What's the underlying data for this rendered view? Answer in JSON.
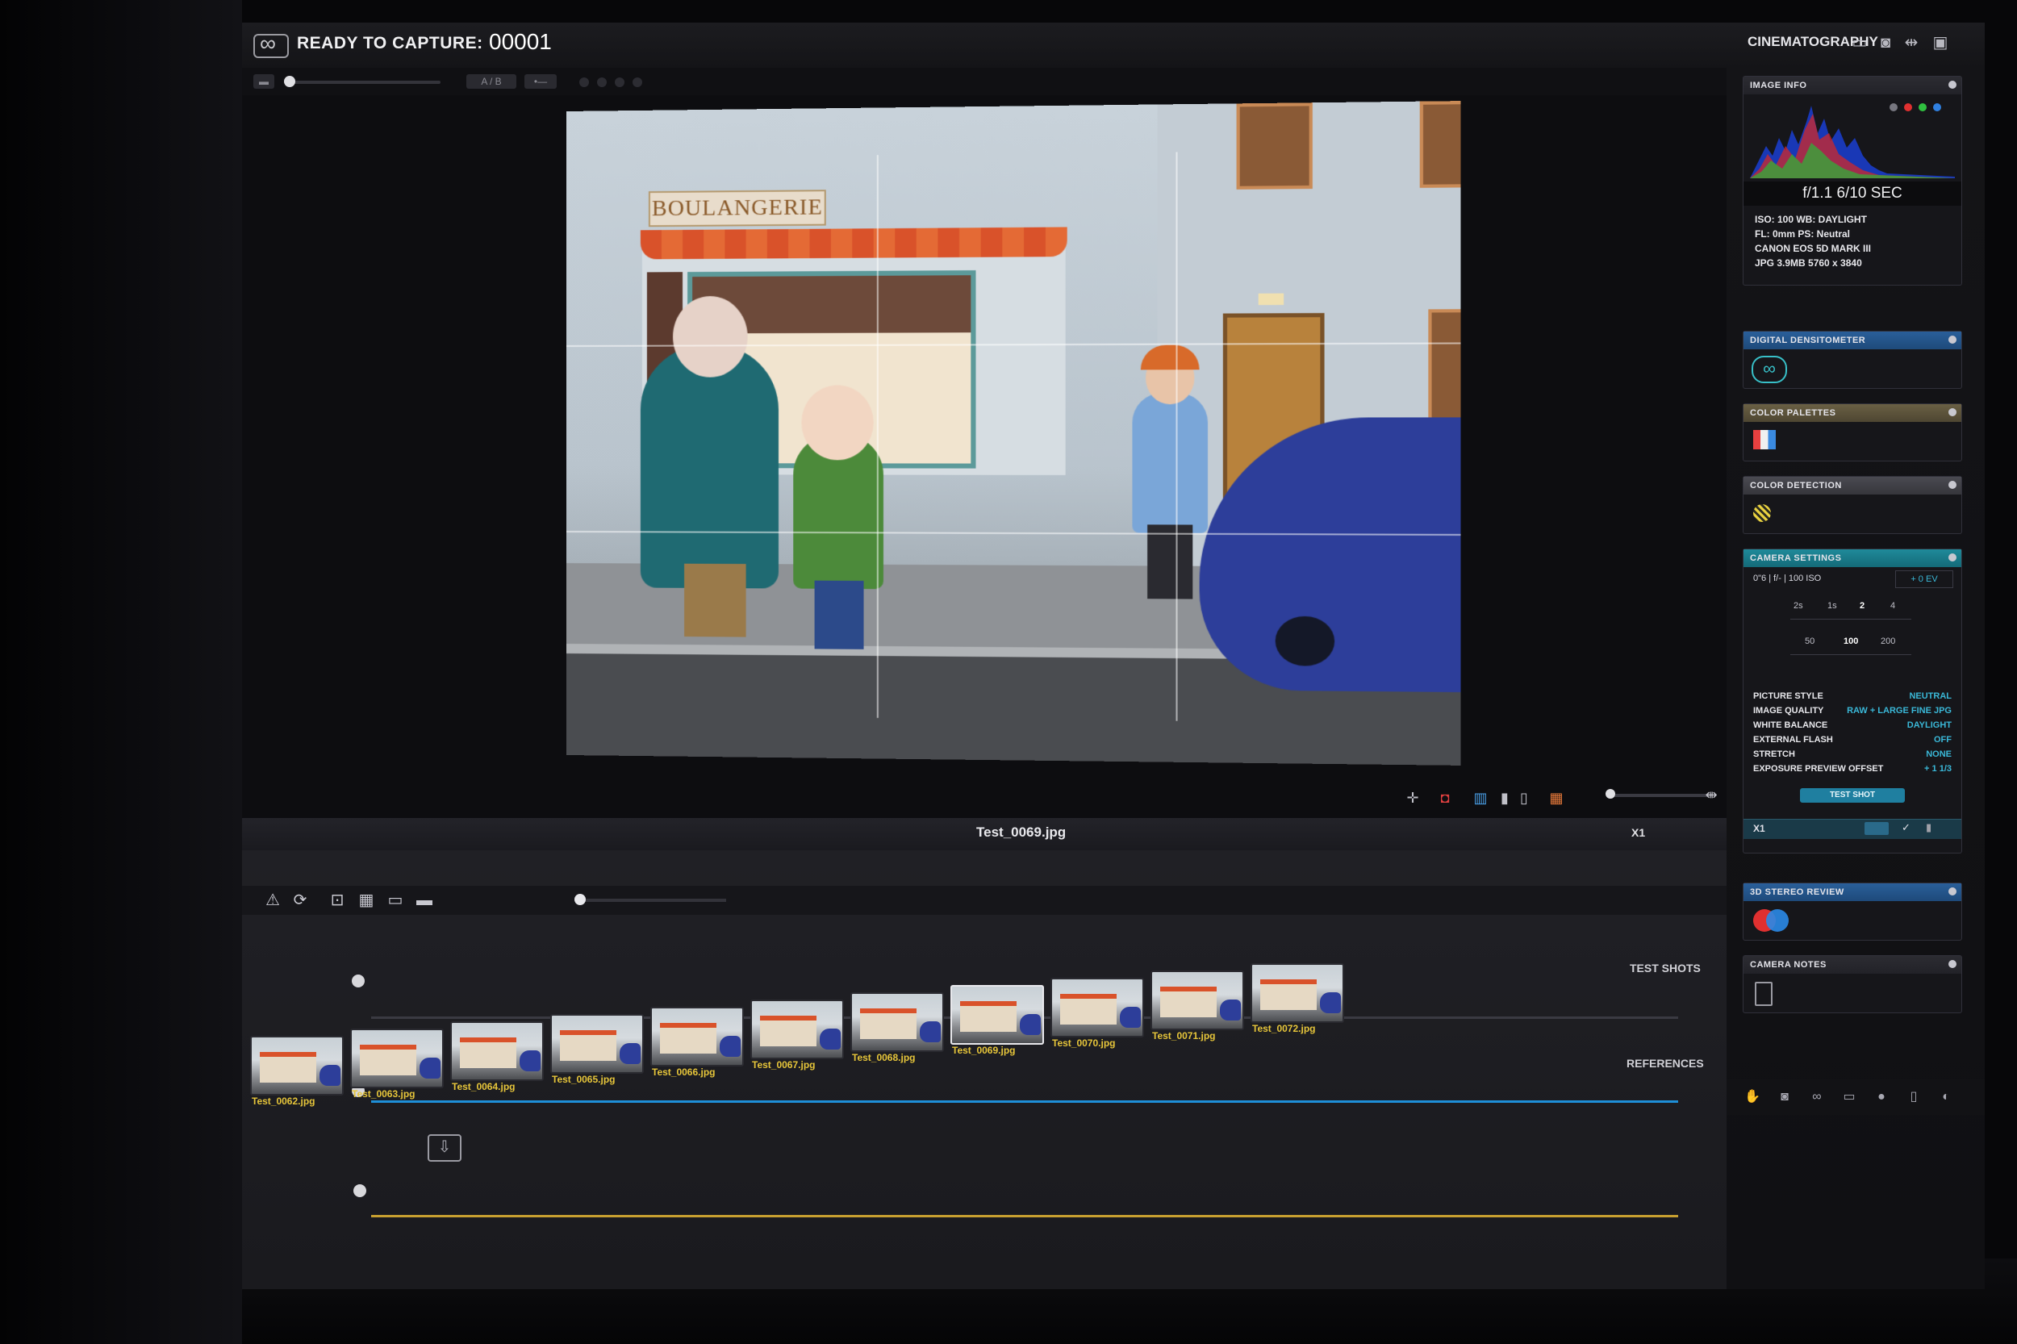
{
  "app": {
    "capture_status": "READY TO CAPTURE:",
    "frame_number": "00001",
    "workspace": "CINEMATOGRAPHY",
    "ab_toggle": "A / B"
  },
  "viewer": {
    "scene_sign": "BOULANGERIE",
    "filename": "Test_0069.jpg",
    "zoom": "X1"
  },
  "timeline": {
    "tracks": [
      {
        "label": "TEST SHOTS",
        "accent": "#1e8fd8"
      },
      {
        "label": "REFERENCES",
        "accent": "#1e8fd8"
      },
      {
        "label": "",
        "accent": "#c8a030"
      }
    ],
    "thumbnails": [
      {
        "label": "Test_0062.jpg",
        "selected": false
      },
      {
        "label": "Test_0063.jpg",
        "selected": false
      },
      {
        "label": "Test_0064.jpg",
        "selected": false
      },
      {
        "label": "Test_0065.jpg",
        "selected": false
      },
      {
        "label": "Test_0066.jpg",
        "selected": false
      },
      {
        "label": "Test_0067.jpg",
        "selected": false
      },
      {
        "label": "Test_0068.jpg",
        "selected": false
      },
      {
        "label": "Test_0069.jpg",
        "selected": true
      },
      {
        "label": "Test_0070.jpg",
        "selected": false
      },
      {
        "label": "Test_0071.jpg",
        "selected": false
      },
      {
        "label": "Test_0072.jpg",
        "selected": false
      }
    ]
  },
  "image_info": {
    "title": "IMAGE INFO",
    "exposure": "f/1.1   6/10 SEC",
    "lines": [
      "ISO: 100   WB: DAYLIGHT",
      "FL: 0mm   PS: Neutral",
      "CANON EOS 5D MARK III",
      "JPG  3.9MB  5760 x 3840"
    ]
  },
  "widgets": {
    "densitometer": "DIGITAL DENSITOMETER",
    "palettes": "COLOR PALETTES",
    "detection": "COLOR DETECTION",
    "camera_settings": "CAMERA SETTINGS",
    "stereo": "3D STEREO REVIEW",
    "notes": "CAMERA NOTES"
  },
  "camera_settings": {
    "summary": "0\"6 | f/- | 100 ISO",
    "ev": "+ 0 EV",
    "aperture_ticks": [
      "2s",
      "1s",
      "2",
      "4"
    ],
    "iso_ticks": [
      "50",
      "100",
      "200"
    ],
    "rows": [
      {
        "label": "PICTURE STYLE",
        "value": "NEUTRAL"
      },
      {
        "label": "IMAGE QUALITY",
        "value": "RAW + LARGE FINE JPG"
      },
      {
        "label": "WHITE BALANCE",
        "value": "DAYLIGHT"
      },
      {
        "label": "EXTERNAL FLASH",
        "value": "OFF"
      },
      {
        "label": "STRETCH",
        "value": "NONE"
      },
      {
        "label": "EXPOSURE PREVIEW OFFSET",
        "value": "+ 1 1/3"
      }
    ],
    "test_shot": "TEST SHOT",
    "shot_count": "X1"
  }
}
